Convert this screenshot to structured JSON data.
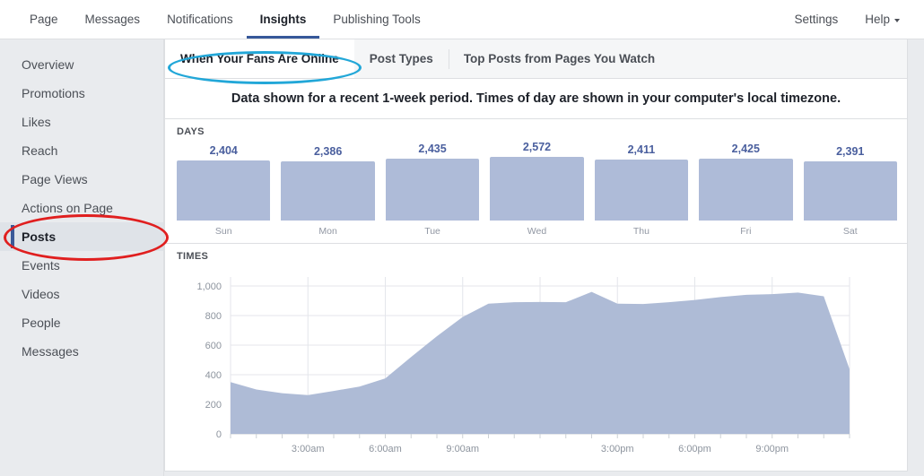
{
  "topnav": {
    "left_items": [
      {
        "label": "Page",
        "active": false
      },
      {
        "label": "Messages",
        "active": false
      },
      {
        "label": "Notifications",
        "active": false
      },
      {
        "label": "Insights",
        "active": true
      },
      {
        "label": "Publishing Tools",
        "active": false
      }
    ],
    "right_items": [
      {
        "label": "Settings",
        "has_caret": false
      },
      {
        "label": "Help",
        "has_caret": true
      }
    ],
    "active_underline_color": "#365899"
  },
  "sidebar": {
    "items": [
      {
        "label": "Overview",
        "active": false
      },
      {
        "label": "Promotions",
        "active": false
      },
      {
        "label": "Likes",
        "active": false
      },
      {
        "label": "Reach",
        "active": false
      },
      {
        "label": "Page Views",
        "active": false
      },
      {
        "label": "Actions on Page",
        "active": false
      },
      {
        "label": "Posts",
        "active": true
      },
      {
        "label": "Events",
        "active": false
      },
      {
        "label": "Videos",
        "active": false
      },
      {
        "label": "People",
        "active": false
      },
      {
        "label": "Messages",
        "active": false
      }
    ],
    "active_marker_color": "#3b5998"
  },
  "tabs": [
    {
      "label": "When Your Fans Are Online",
      "active": true
    },
    {
      "label": "Post Types",
      "active": false
    },
    {
      "label": "Top Posts from Pages You Watch",
      "active": false
    }
  ],
  "subtitle": "Data shown for a recent 1-week period. Times of day are shown in your computer's local timezone.",
  "sections": {
    "days_label": "DAYS",
    "times_label": "TIMES"
  },
  "annotations": [
    {
      "name": "posts-highlight",
      "shape": "ellipse",
      "color": "#e01f1f",
      "target": "Posts"
    },
    {
      "name": "when-your-fans-are-online-highlight",
      "shape": "ellipse",
      "color": "#22a7d8",
      "target": "When Your Fans Are Online"
    }
  ],
  "chart_data": [
    {
      "type": "bar",
      "title": "DAYS",
      "xlabel": "",
      "ylabel": "",
      "categories": [
        "Sun",
        "Mon",
        "Tue",
        "Wed",
        "Thu",
        "Fri",
        "Sat"
      ],
      "values": [
        2404,
        2386,
        2435,
        2572,
        2411,
        2425,
        2391
      ],
      "value_labels": [
        "2,404",
        "2,386",
        "2,435",
        "2,572",
        "2,411",
        "2,425",
        "2,391"
      ],
      "bar_color": "#aebbd8",
      "value_label_color": "#4a5f9e",
      "ylim": [
        0,
        2572
      ],
      "grid": false,
      "legend": "none"
    },
    {
      "type": "area",
      "title": "TIMES",
      "xlabel": "",
      "ylabel": "",
      "ylim": [
        0,
        1000
      ],
      "yticks": [
        0,
        200,
        400,
        600,
        800,
        1000
      ],
      "ytick_labels": [
        "0",
        "200",
        "400",
        "600",
        "800",
        "1,000"
      ],
      "xticks": [
        "12:00am",
        "3:00am",
        "6:00am",
        "9:00am",
        "12:00pm",
        "3:00pm",
        "6:00pm",
        "9:00pm"
      ],
      "xtick_labels_shown": [
        "",
        "3:00am",
        "6:00am",
        "9:00am",
        "",
        "3:00pm",
        "6:00pm",
        "9:00pm"
      ],
      "grid": true,
      "legend": "none",
      "area_color": "#aebbd6",
      "x": [
        "12am",
        "1am",
        "2am",
        "3am",
        "4am",
        "5am",
        "6am",
        "7am",
        "8am",
        "9am",
        "10am",
        "11am",
        "12pm",
        "1pm",
        "2pm",
        "3pm",
        "4pm",
        "5pm",
        "6pm",
        "7pm",
        "8pm",
        "9pm",
        "10pm",
        "11pm"
      ],
      "values": [
        350,
        300,
        275,
        262,
        290,
        320,
        375,
        520,
        660,
        790,
        880,
        890,
        892,
        890,
        960,
        880,
        878,
        890,
        905,
        925,
        940,
        945,
        955,
        930
      ]
    }
  ]
}
